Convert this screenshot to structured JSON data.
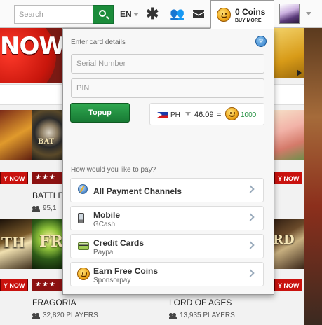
{
  "header": {
    "search_placeholder": "Search",
    "language": "EN",
    "icons": [
      "asterisk-icon",
      "friends-icon",
      "mail-icon"
    ],
    "coins_amount": "0 Coins",
    "buy_more": "BUY MORE"
  },
  "background": {
    "hero_text": "NOW!",
    "buy_now": "Y NOW",
    "stars": "★★★",
    "thumb_texts": [
      "BAT",
      "TH",
      "FR",
      "RD"
    ],
    "games": [
      {
        "title": "BATTLE",
        "players": "95,1"
      },
      {
        "title": "FRAGORIA",
        "players": "32,820 PLAYERS"
      },
      {
        "title": "LORD OF AGES",
        "players": "13,935 PLAYERS"
      }
    ]
  },
  "panel": {
    "heading": "Enter card details",
    "serial_placeholder": "Serial Number",
    "pin_placeholder": "PIN",
    "topup_label": "Topup",
    "country": "PH",
    "rate_value": "46.09",
    "rate_equals": "=",
    "rate_coins": "1000",
    "pay_question": "How would you like to pay?",
    "payment_options": [
      {
        "title": "All Payment Channels",
        "subtitle": ""
      },
      {
        "title": "Mobile",
        "subtitle": "GCash"
      },
      {
        "title": "Credit Cards",
        "subtitle": "Paypal"
      },
      {
        "title": "Earn Free Coins",
        "subtitle": "Sponsorpay"
      }
    ]
  },
  "colors": {
    "accent_green": "#1b8c3a",
    "buy_now_red": "#c9120e",
    "coin_gold": "#f0a81a"
  }
}
